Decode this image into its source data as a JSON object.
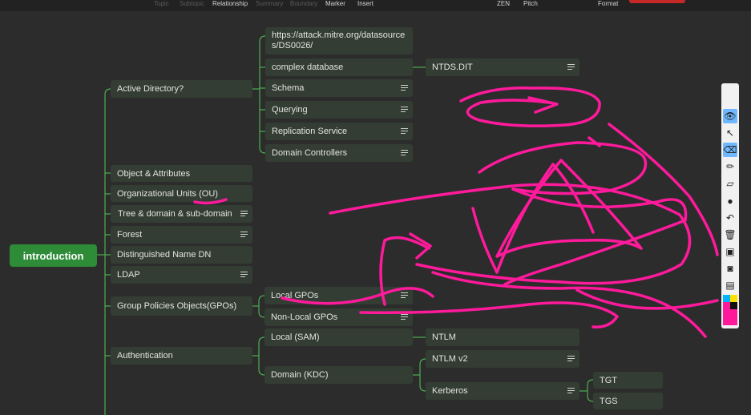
{
  "toolbar": {
    "items": [
      "Topic",
      "Subtopic",
      "Relationship",
      "Summary",
      "Boundary",
      "Marker",
      "Insert",
      "ZEN",
      "Pitch",
      "Format"
    ]
  },
  "mindmap": {
    "root": "introduction",
    "level1": [
      "Active Directory?",
      "Object & Attributes",
      "Organizational Units (OU)",
      "Tree & domain & sub-domain",
      "Forest",
      "Distinguished Name DN",
      "LDAP",
      "Group Policies Objects(GPOs)",
      "Authentication"
    ],
    "ad_children": [
      "https://attack.mitre.org/datasources/DS0026/",
      "complex database",
      "Schema",
      "Querying",
      "Replication Service",
      "Domain Controllers"
    ],
    "complex_db_child": "NTDS.DIT",
    "gpo_children": [
      "Local GPOs",
      "Non-Local GPOs"
    ],
    "auth_children": [
      "Local (SAM)",
      "Domain (KDC)"
    ],
    "sam_child": "NTLM",
    "kdc_children": [
      "NTLM v2",
      "Kerberos"
    ],
    "kerberos_children": [
      "TGT",
      "TGS"
    ]
  },
  "colors": {
    "background": "#2c2c2c",
    "node": "#333d33",
    "root": "#2e8b37",
    "connector": "#4caf50",
    "ink": "#ff1a9c",
    "highlight_underline": "#ff1a9c"
  },
  "drawing_tools": [
    "pen-logo-icon",
    "eye-icon",
    "cursor-icon",
    "eraser-icon",
    "pen-icon",
    "highlighter-icon",
    "dot-icon",
    "undo-icon",
    "trash-icon",
    "camera-icon",
    "screenshot-icon",
    "clipboard-icon",
    "color-palette-icon"
  ]
}
